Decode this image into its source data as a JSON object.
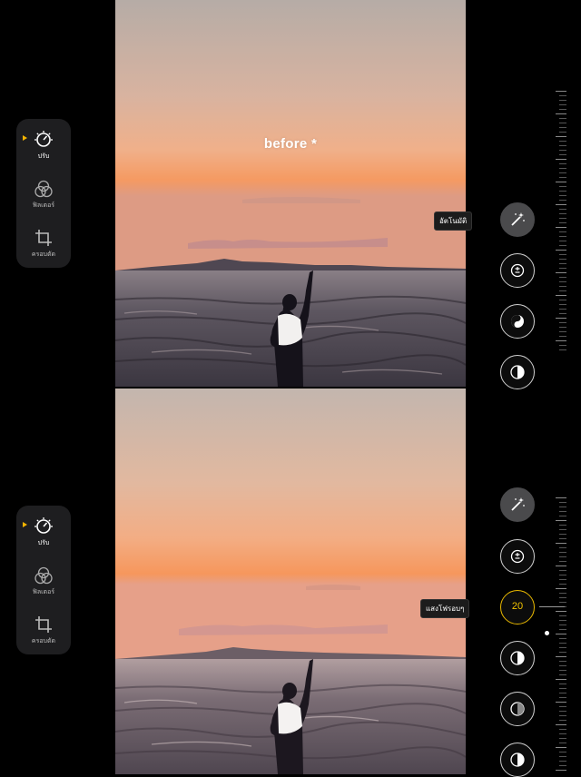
{
  "compare_label": "before *",
  "side_panel": {
    "top": [
      {
        "icon": "dial-icon",
        "label": "ปรับ",
        "active": true
      },
      {
        "icon": "filter-icon",
        "label": "ฟิลเตอร์",
        "active": false
      },
      {
        "icon": "crop-icon",
        "label": "ครอบตัด",
        "active": false
      }
    ],
    "bottom": [
      {
        "icon": "dial-icon",
        "label": "ปรับ",
        "active": true
      },
      {
        "icon": "filter-icon",
        "label": "ฟิลเตอร์",
        "active": false
      },
      {
        "icon": "crop-icon",
        "label": "ครอบตัด",
        "active": false
      }
    ]
  },
  "adjustments": {
    "top_active_label": "อัตโนมัติ",
    "bottom_active_label": "แสงโฟรอบๆ",
    "bottom_active_value": "20",
    "top_icons": [
      "magic-wand-icon",
      "exposure-face-icon",
      "yin-yang-icon",
      "half-circle-icon"
    ],
    "bottom_icons": [
      "magic-wand-icon",
      "exposure-face-icon",
      "brilliance-icon",
      "half-circle-icon",
      "contrast-icon",
      "half-circle-icon"
    ]
  },
  "colors": {
    "accent": "#f5b400",
    "panel_bg": "#1e1e20",
    "sky_top": "#b7aca4",
    "sky_glow": "#f49a63"
  }
}
